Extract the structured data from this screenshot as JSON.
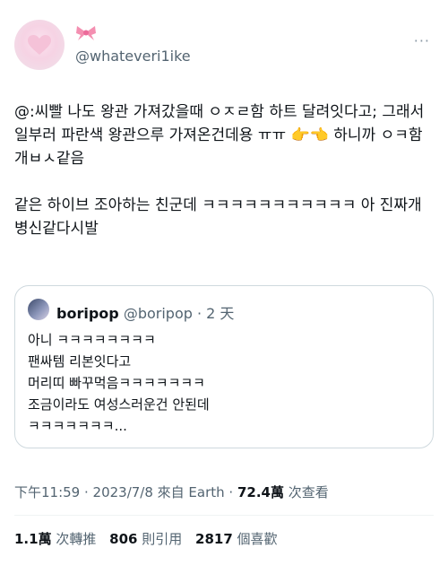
{
  "author": {
    "handle": "@whateveri1ike",
    "avatar_icon": "pink-heart-icon",
    "badge_icon": "ribbon-bow-icon"
  },
  "more_icon": "more-options-icon",
  "tweet": {
    "paragraphs": [
      "@:씨빨 나도 왕관 가져갔을때 ㅇㅈㄹ함 하트 달려잇다고; 그래서 일부러 파란색 왕관으루 가져온건데용 ㅠㅠ 👉👈 하니까 ㅇㅋ함 개ㅂㅅ같음",
      "같은 하이브 조아하는 친군데 ㅋㅋㅋㅋㅋㅋㅋㅋㅋㅋㅋ 아 진짜개병신같다시발"
    ]
  },
  "quote": {
    "name": "boripop",
    "handle": "@boripop",
    "time": "· 2 天",
    "lines": [
      "아니 ㅋㅋㅋㅋㅋㅋㅋㅋ",
      "팬싸템 리본잇다고",
      "머리띠 빠꾸먹음ㅋㅋㅋㅋㅋㅋㅋ",
      "조금이라도 여성스러운건 안된데",
      "ㅋㅋㅋㅋㅋㅋㅋ..."
    ]
  },
  "meta": {
    "time": "下午11:59 · 2023/7/8 來自 Earth · ",
    "views_count": "72.4萬",
    "views_label": " 次查看"
  },
  "stats": {
    "retweets_count": "1.1萬",
    "retweets_label": " 次轉推",
    "quotes_count": "806",
    "quotes_label": " 則引用",
    "likes_count": "2817",
    "likes_label": " 個喜歡"
  }
}
